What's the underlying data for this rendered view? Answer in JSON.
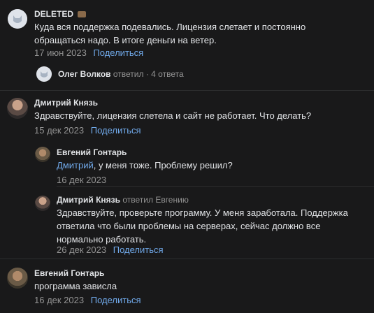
{
  "comments": [
    {
      "author": "DELETED",
      "text": "Куда вся поддержка подевались. Лицензия слетает и постоянно обращаться надо. В итоге деньги на ветер.",
      "date": "17 июн 2023",
      "share": "Поделиться",
      "thread": {
        "author": "Олег Волков",
        "action": "ответил",
        "sep": " · ",
        "count": "4 ответа"
      }
    },
    {
      "author": "Дмитрий Князь",
      "text": "Здравствуйте, лицензия слетела и сайт не работает. Что делать?",
      "date": "15 дек 2023",
      "share": "Поделиться"
    },
    {
      "author": "Евгений Гонтарь",
      "mention": "Дмитрий",
      "text": ", у меня тоже. Проблему решил?",
      "date": "16 дек 2023"
    },
    {
      "author": "Дмитрий Князь",
      "reply_to": "ответил Евгению",
      "text": "Здравствуйте, проверьте программу. У меня заработала. Поддержка ответила что были проблемы на серверах, сейчас должно все нормально работать.",
      "date": "26 дек 2023",
      "share": "Поделиться"
    },
    {
      "author": "Евгений Гонтарь",
      "text": "программа зависла",
      "date": "16 дек 2023",
      "share": "Поделиться"
    }
  ]
}
